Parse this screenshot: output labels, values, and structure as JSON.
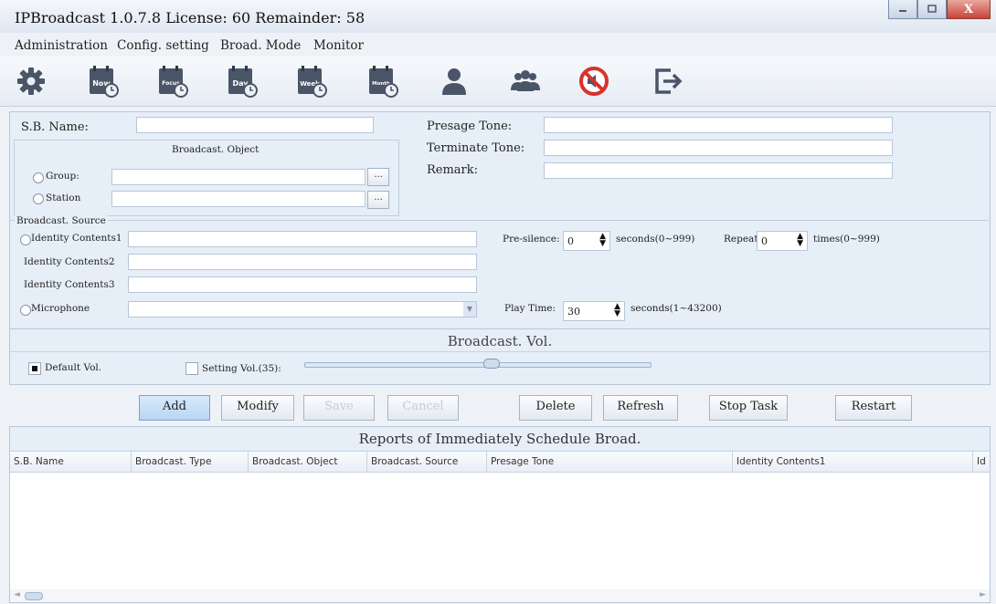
{
  "window": {
    "title": "IPBroadcast 1.0.7.8 License: 60 Remainder: 58",
    "close_glyph": "X"
  },
  "menu": {
    "items": [
      {
        "label": "Administration"
      },
      {
        "label": "Config. setting"
      },
      {
        "label": "Broad. Mode"
      },
      {
        "label": "Monitor"
      }
    ]
  },
  "toolbar": {
    "buttons": [
      {
        "icon": "gear-icon"
      },
      {
        "icon": "calendar-now-icon",
        "label": "Now"
      },
      {
        "icon": "calendar-focus-icon",
        "label": "Focus"
      },
      {
        "icon": "calendar-day-icon",
        "label": "Day"
      },
      {
        "icon": "calendar-week-icon",
        "label": "Week"
      },
      {
        "icon": "calendar-month-icon",
        "label": "Month"
      },
      {
        "icon": "user-icon"
      },
      {
        "icon": "group-icon"
      },
      {
        "icon": "mute-icon"
      },
      {
        "icon": "exit-icon"
      }
    ]
  },
  "form": {
    "sb_name_label": "S.B. Name:",
    "presage_tone_label": "Presage Tone:",
    "terminate_tone_label": "Terminate Tone:",
    "remark_label": "Remark:",
    "broadcast_object": {
      "title": "Broadcast. Object",
      "group_label": "Group:",
      "station_label": "Station",
      "browse_label": "..."
    },
    "broadcast_source": {
      "title": "Broadcast. Source",
      "identity1_label": "Identity Contents1",
      "identity2_label": "Identity Contents2",
      "identity3_label": "Identity Contents3",
      "microphone_label": "Microphone"
    },
    "pre_silence": {
      "label": "Pre-silence:",
      "value": "0",
      "unit": "seconds(0~999)"
    },
    "repeat": {
      "label": "Repeat:",
      "value": "0",
      "unit": "times(0~999)"
    },
    "play_time": {
      "label": "Play Time:",
      "value": "30",
      "unit": "seconds(1~43200)"
    }
  },
  "volume": {
    "title": "Broadcast. Vol.",
    "default_label": "Default Vol.",
    "setting_label": "Setting Vol.(35):",
    "default_checked": true,
    "setting_checked": false,
    "level": 35
  },
  "actions": {
    "add": "Add",
    "modify": "Modify",
    "save": "Save",
    "cancel": "Cancel",
    "delete": "Delete",
    "refresh": "Refresh",
    "stop_task": "Stop Task",
    "restart": "Restart"
  },
  "reports": {
    "title": "Reports of Immediately Schedule Broad.",
    "columns": [
      "S.B. Name",
      "Broadcast. Type",
      "Broadcast. Object",
      "Broadcast. Source",
      "Presage Tone",
      "Identity Contents1",
      "Id"
    ]
  },
  "colors": {
    "accent": "#3a6ea5",
    "icon_dark": "#4a5568",
    "mute_red": "#d8322d"
  }
}
